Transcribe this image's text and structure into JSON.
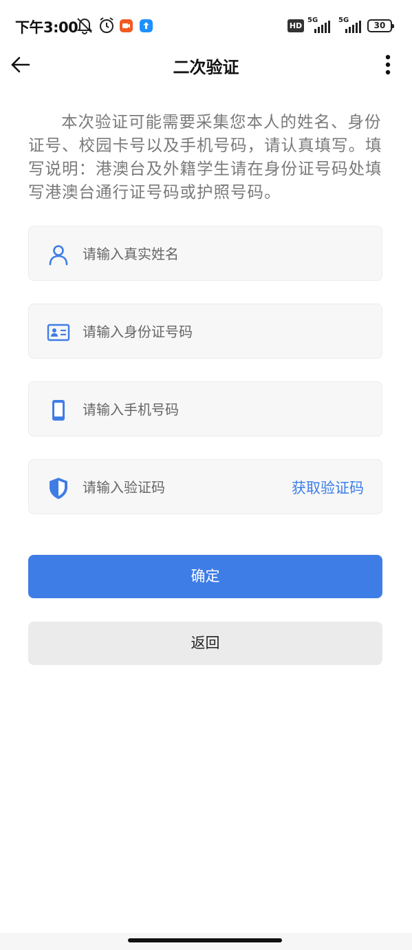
{
  "status_bar": {
    "time": "下午3:00",
    "hd_label": "HD",
    "network1": "5G",
    "network2": "5G",
    "battery": "30",
    "icons": [
      "mute-icon",
      "alarm-icon",
      "video-app-icon",
      "upload-app-icon"
    ]
  },
  "header": {
    "title": "二次验证",
    "back_icon": "arrow-left-icon",
    "more_icon": "more-vertical-icon"
  },
  "description": "本次验证可能需要采集您本人的姓名、身份证号、校园卡号以及手机号码，请认真填写。填写说明：港澳台及外籍学生请在身份证号码处填写港澳台通行证号码或护照号码。",
  "form": {
    "name": {
      "placeholder": "请输入真实姓名",
      "value": "",
      "icon": "person-icon"
    },
    "id_number": {
      "placeholder": "请输入身份证号码",
      "value": "",
      "icon": "id-card-icon"
    },
    "phone": {
      "placeholder": "请输入手机号码",
      "value": "",
      "icon": "phone-icon"
    },
    "code": {
      "placeholder": "请输入验证码",
      "value": "",
      "icon": "shield-icon",
      "get_code_label": "获取验证码"
    }
  },
  "buttons": {
    "confirm": "确定",
    "back": "返回"
  },
  "colors": {
    "accent": "#3f7de6",
    "link": "#3b7de9",
    "description_text": "#7a7a7a",
    "field_bg": "#f7f7f7",
    "secondary_button_bg": "#ebebeb"
  }
}
